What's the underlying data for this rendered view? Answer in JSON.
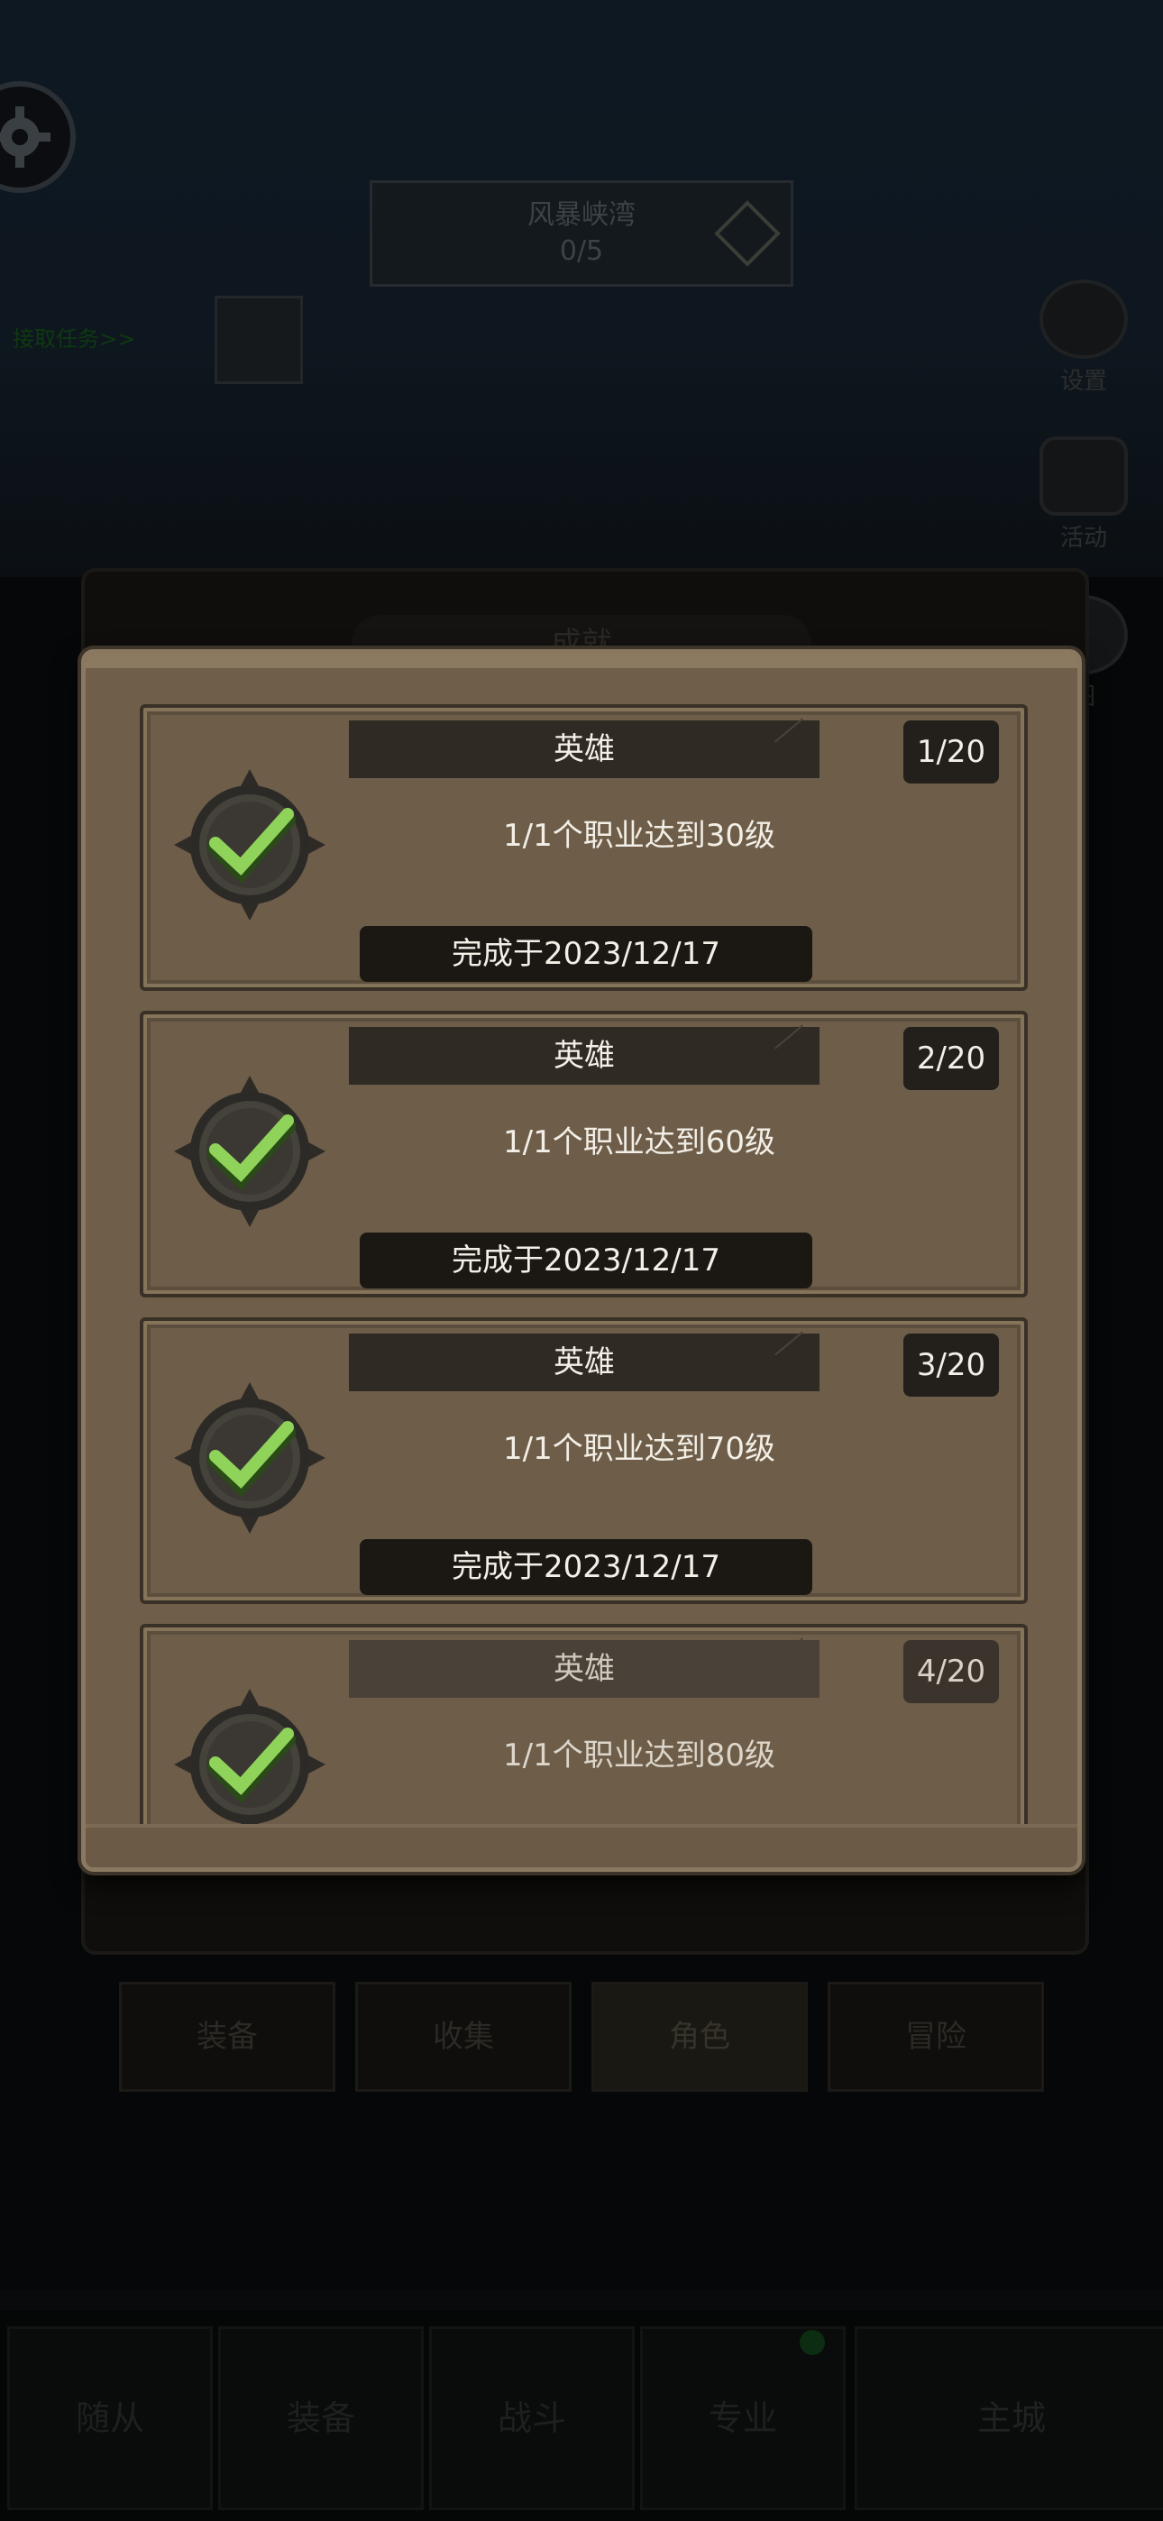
{
  "background": {
    "area_banner": {
      "name": "风暴峡湾",
      "progress": "0/5"
    },
    "quest_link": "接取任务>>",
    "side_icons": [
      {
        "label": "设置",
        "icon": "gear-icon"
      },
      {
        "label": "活动",
        "icon": "cart-icon"
      },
      {
        "label": "图",
        "icon": "coin-icon"
      }
    ],
    "panel_title": "成就",
    "tabs": [
      {
        "label": "装备"
      },
      {
        "label": "收集"
      },
      {
        "label": "角色",
        "active": true
      },
      {
        "label": "冒险"
      }
    ],
    "bottom_nav": [
      {
        "label": "随从"
      },
      {
        "label": "装备"
      },
      {
        "label": "战斗"
      },
      {
        "label": "专业"
      },
      {
        "label": "主城"
      }
    ]
  },
  "achievements": [
    {
      "title": "英雄",
      "count": "1/20",
      "description": "1/1个职业达到30级",
      "completed": "完成于2023/12/17"
    },
    {
      "title": "英雄",
      "count": "2/20",
      "description": "1/1个职业达到60级",
      "completed": "完成于2023/12/17"
    },
    {
      "title": "英雄",
      "count": "3/20",
      "description": "1/1个职业达到70级",
      "completed": "完成于2023/12/17"
    },
    {
      "title": "英雄",
      "count": "4/20",
      "description": "1/1个职业达到80级"
    }
  ],
  "colors": {
    "modal_bg": "#6f5f4a",
    "check_green": "#8fd35a",
    "badge_dark": "#3b3833"
  }
}
